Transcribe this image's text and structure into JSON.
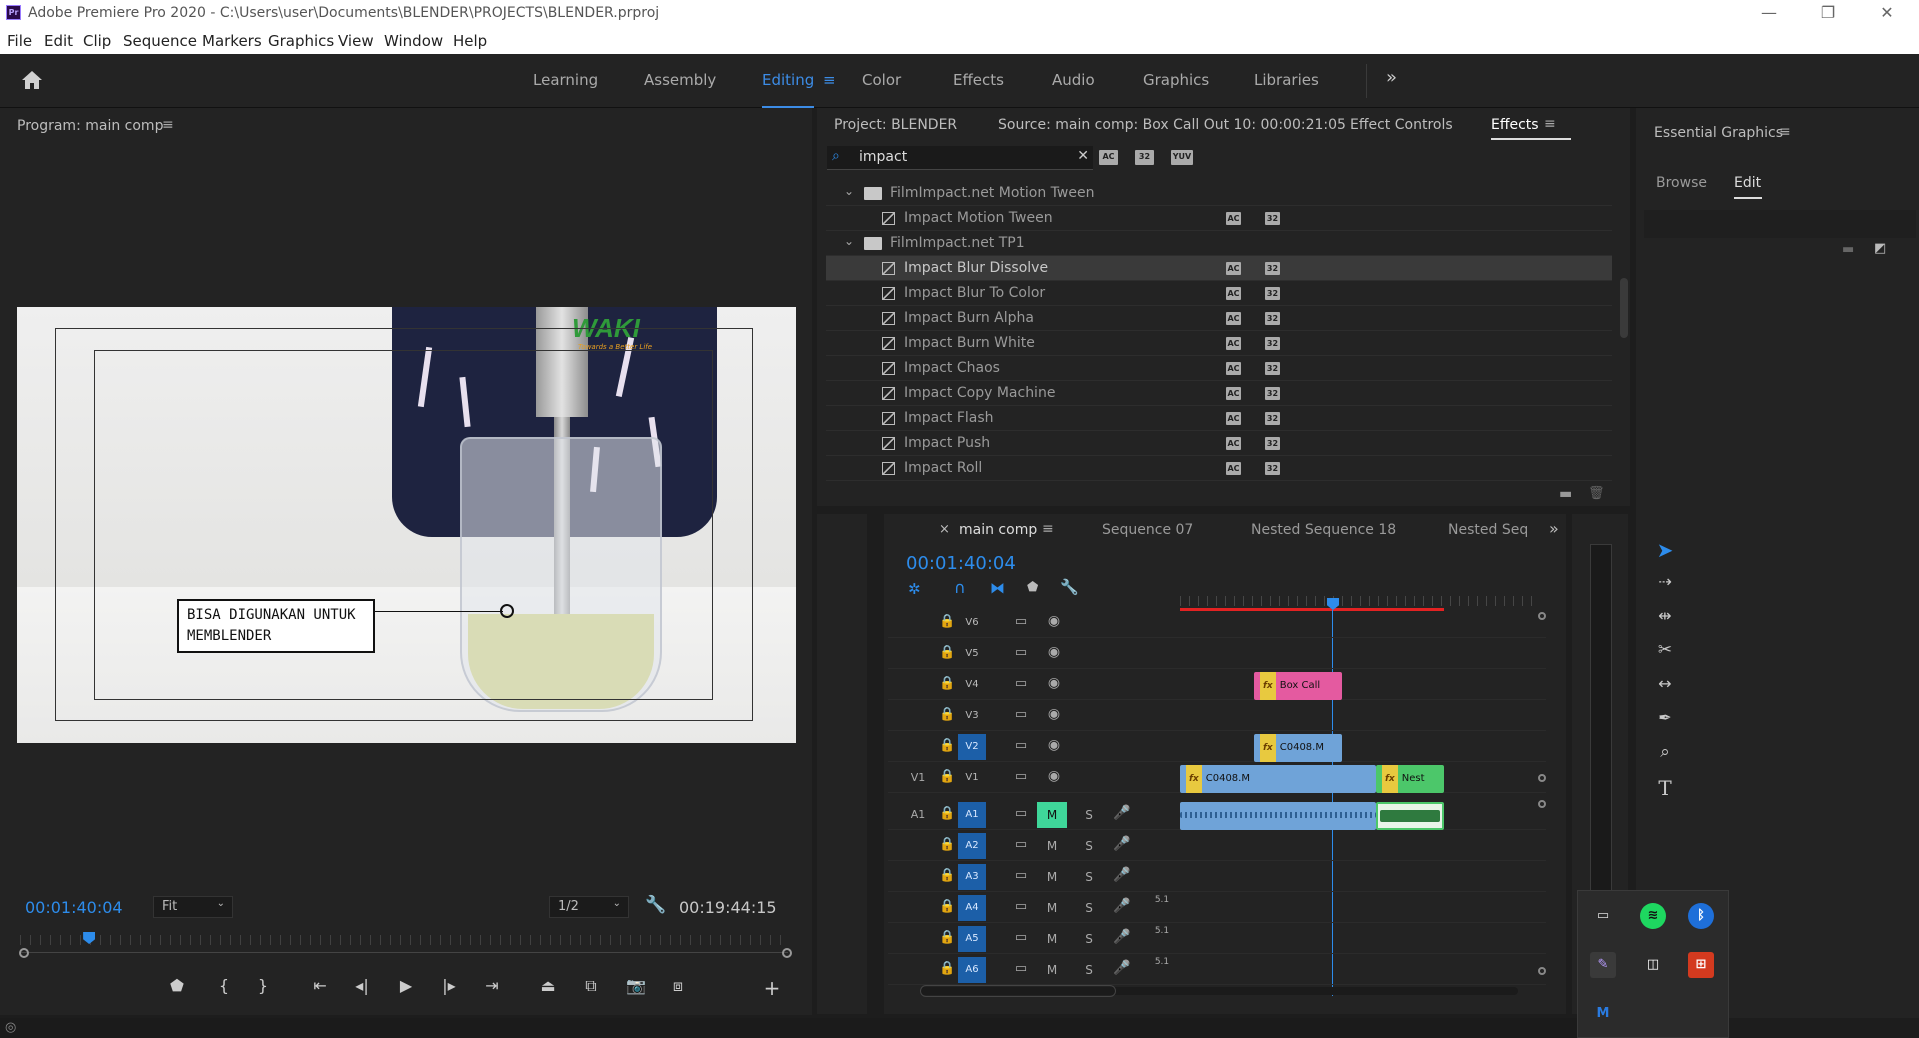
{
  "title_bar": {
    "app_icon": "Pr",
    "title": "Adobe Premiere Pro 2020 - C:\\Users\\user\\Documents\\BLENDER\\PROJECTS\\BLENDER.prproj"
  },
  "menu": [
    "File",
    "Edit",
    "Clip",
    "Sequence",
    "Markers",
    "Graphics",
    "View",
    "Window",
    "Help"
  ],
  "workspaces": {
    "items": [
      "Learning",
      "Assembly",
      "Editing",
      "Color",
      "Effects",
      "Audio",
      "Graphics",
      "Libraries"
    ],
    "active": "Editing",
    "more": "»"
  },
  "program_monitor": {
    "title": "Program: main comp",
    "overlay_text_line1": "BISA DIGUNAKAN UNTUK",
    "overlay_text_line2": "MEMBLENDER",
    "logo_text": "WAKI",
    "logo_tagline": "Towards a Better Life",
    "timecode": "00:01:40:04",
    "zoom": "Fit",
    "resolution": "1/2",
    "duration": "00:19:44:15",
    "playhead_position": 0.09
  },
  "project_panel": {
    "tabs": [
      "Project: BLENDER",
      "Source: main comp: Box Call Out 10: 00:00:21:05",
      "Effect Controls",
      "Effects"
    ],
    "active_tab": "Effects",
    "search_value": "impact",
    "filter_badges": [
      "AC",
      "32",
      "YUV"
    ],
    "tree": [
      {
        "type": "folder",
        "label": "FilmImpact.net Motion Tween"
      },
      {
        "type": "effect",
        "label": "Impact Motion Tween",
        "badges": [
          "AC",
          "32"
        ]
      },
      {
        "type": "folder",
        "label": "FilmImpact.net TP1"
      },
      {
        "type": "effect",
        "label": "Impact Blur Dissolve",
        "badges": [
          "AC",
          "32"
        ],
        "selected": true
      },
      {
        "type": "effect",
        "label": "Impact Blur To Color",
        "badges": [
          "AC",
          "32"
        ]
      },
      {
        "type": "effect",
        "label": "Impact Burn Alpha",
        "badges": [
          "AC",
          "32"
        ]
      },
      {
        "type": "effect",
        "label": "Impact Burn White",
        "badges": [
          "AC",
          "32"
        ]
      },
      {
        "type": "effect",
        "label": "Impact Chaos",
        "badges": [
          "AC",
          "32"
        ]
      },
      {
        "type": "effect",
        "label": "Impact Copy Machine",
        "badges": [
          "AC",
          "32"
        ]
      },
      {
        "type": "effect",
        "label": "Impact Flash",
        "badges": [
          "AC",
          "32"
        ]
      },
      {
        "type": "effect",
        "label": "Impact Push",
        "badges": [
          "AC",
          "32"
        ]
      },
      {
        "type": "effect",
        "label": "Impact Roll",
        "badges": [
          "AC",
          "32"
        ]
      }
    ]
  },
  "essential_graphics": {
    "title": "Essential Graphics",
    "tabs": [
      "Browse",
      "Edit"
    ],
    "active_tab": "Edit"
  },
  "timeline": {
    "tabs": [
      "main comp",
      "Sequence 07",
      "Nested Sequence 18",
      "Nested Seq"
    ],
    "active_tab": "main comp",
    "close_glyph": "×",
    "timecode": "00:01:40:04",
    "video_tracks": [
      {
        "name": "V6",
        "source": "",
        "active": false
      },
      {
        "name": "V5",
        "source": "",
        "active": false
      },
      {
        "name": "V4",
        "source": "",
        "active": false
      },
      {
        "name": "V3",
        "source": "",
        "active": false
      },
      {
        "name": "V2",
        "source": "",
        "active": true
      },
      {
        "name": "V1",
        "source": "V1",
        "active": false
      }
    ],
    "audio_tracks": [
      {
        "name": "A1",
        "source": "A1",
        "active": true,
        "mute_on": true,
        "channels": ""
      },
      {
        "name": "A2",
        "source": "",
        "active": true,
        "mute_on": false,
        "channels": ""
      },
      {
        "name": "A3",
        "source": "",
        "active": true,
        "mute_on": false,
        "channels": ""
      },
      {
        "name": "A4",
        "source": "",
        "active": true,
        "mute_on": false,
        "channels": "5.1"
      },
      {
        "name": "A5",
        "source": "",
        "active": true,
        "mute_on": false,
        "channels": "5.1"
      },
      {
        "name": "A6",
        "source": "",
        "active": true,
        "mute_on": false,
        "channels": "5.1"
      }
    ],
    "mute_label": "M",
    "solo_label": "S",
    "fx_label": "fx",
    "clips": [
      {
        "track": "V4",
        "label": "Box Call",
        "color": "#e45aa0"
      },
      {
        "track": "V2",
        "label": "C0408.M",
        "color": "#6fa3d8"
      },
      {
        "track": "V1",
        "label": "C0408.M",
        "color": "#6fa3d8"
      },
      {
        "track": "V1",
        "label": "Nest",
        "color": "#4cc76a"
      }
    ]
  },
  "colors": {
    "accent": "#2d8ceb",
    "panel_bg": "#232323",
    "app_bg": "#1d1d1d",
    "mute_on": "#3fd79a",
    "playhead": "#2d8ceb",
    "work_area": "#e32222"
  },
  "tray_icons": [
    "monitor-icon",
    "spotify-icon",
    "bluetooth-icon",
    "pen-icon",
    "reader-icon",
    "office-icon",
    "m-icon"
  ]
}
